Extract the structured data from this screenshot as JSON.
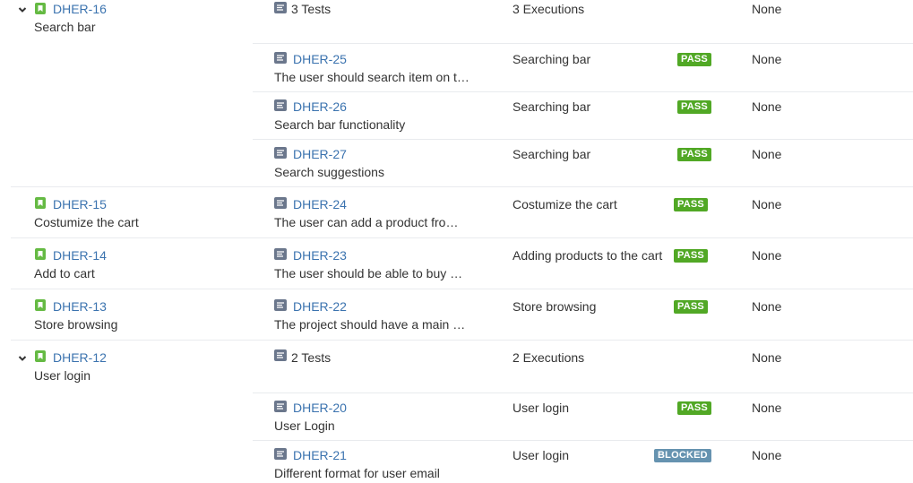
{
  "rows": [
    {
      "story": {
        "key": "DHER-16",
        "title": "Search bar",
        "expanded": true
      },
      "group": {
        "tests_label": "3 Tests",
        "executions_label": "3 Executions",
        "defects": "None"
      },
      "tests": [
        {
          "key": "DHER-25",
          "summary": "The user should search item on the search bar",
          "execution": "Searching bar",
          "status": "PASS",
          "defects": "None"
        },
        {
          "key": "DHER-26",
          "summary": "Search bar functionality",
          "execution": "Searching bar",
          "status": "PASS",
          "defects": "None"
        },
        {
          "key": "DHER-27",
          "summary": "Search suggestions",
          "execution": "Searching bar",
          "status": "PASS",
          "defects": "None"
        }
      ]
    },
    {
      "story": {
        "key": "DHER-15",
        "title": "Costumize the cart"
      },
      "tests": [
        {
          "key": "DHER-24",
          "summary": "The user can add a product from the catalog",
          "execution": "Costumize the cart",
          "status": "PASS",
          "defects": "None"
        }
      ]
    },
    {
      "story": {
        "key": "DHER-14",
        "title": "Add to cart"
      },
      "tests": [
        {
          "key": "DHER-23",
          "summary": "The user should be able to buy products",
          "execution": "Adding products to the cart",
          "status": "PASS",
          "defects": "None"
        }
      ]
    },
    {
      "story": {
        "key": "DHER-13",
        "title": "Store browsing"
      },
      "tests": [
        {
          "key": "DHER-22",
          "summary": "The project should have a main store page",
          "execution": "Store browsing",
          "status": "PASS",
          "defects": "None"
        }
      ]
    },
    {
      "story": {
        "key": "DHER-12",
        "title": "User login",
        "expanded": true
      },
      "group": {
        "tests_label": "2 Tests",
        "executions_label": "2 Executions",
        "defects": "None"
      },
      "tests": [
        {
          "key": "DHER-20",
          "summary": "User Login",
          "execution": "User login",
          "status": "PASS",
          "defects": "None"
        },
        {
          "key": "DHER-21",
          "summary": "Different format for user email",
          "execution": "User login",
          "status": "BLOCKED",
          "defects": "None"
        }
      ]
    }
  ],
  "colors": {
    "link": "#3b73af",
    "pass": "#51a825",
    "blocked": "#6693b0",
    "story_icon": "#65ba43",
    "test_icon": "#6b778c"
  }
}
